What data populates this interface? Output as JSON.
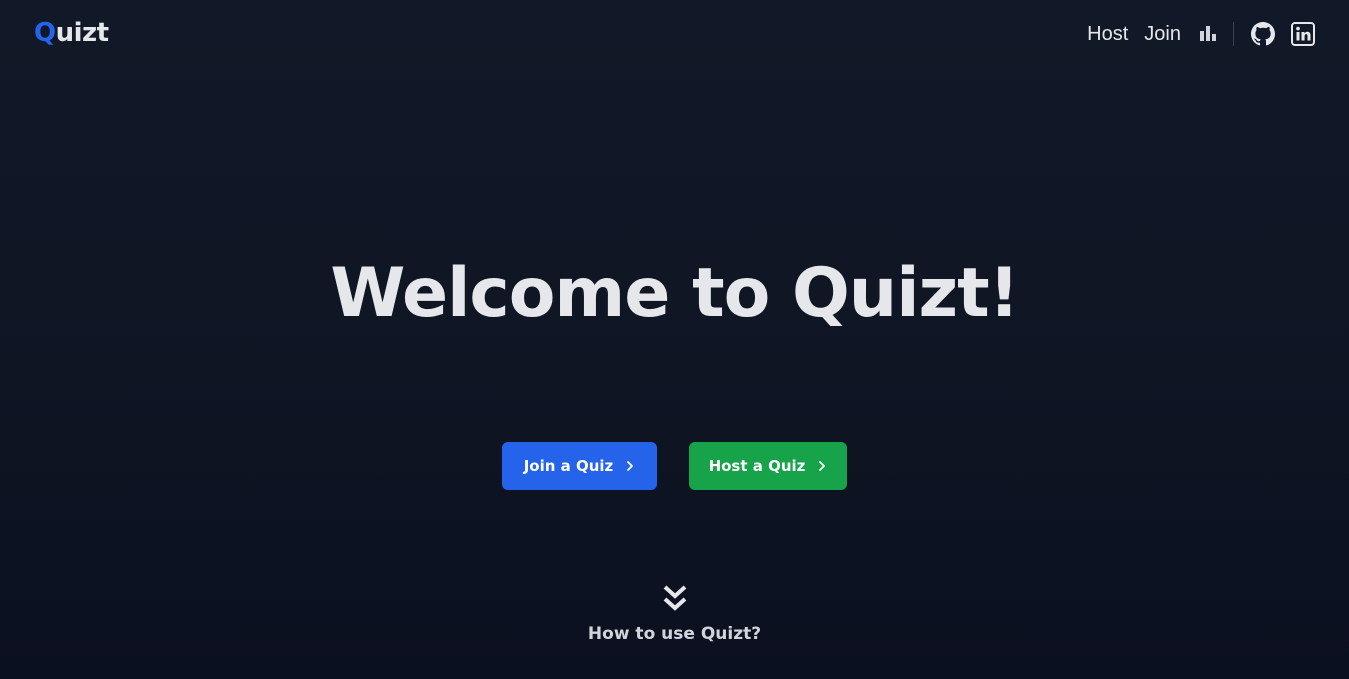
{
  "navbar": {
    "logo_first": "Q",
    "logo_rest": "uizt",
    "links": [
      "Host",
      "Join"
    ],
    "icons": [
      "bar-chart-icon",
      "github-icon",
      "linkedin-icon"
    ]
  },
  "hero": {
    "title": "Welcome to Quizt!"
  },
  "buttons": {
    "join_label": "Join a Quiz",
    "host_label": "Host a Quiz"
  },
  "howto": {
    "label": "How to use Quizt?",
    "icon": "double-chevron-down-icon"
  },
  "colors": {
    "background": "#111827",
    "accent_blue": "#2563eb",
    "accent_green": "#16a34a",
    "text": "#e5e7eb"
  }
}
